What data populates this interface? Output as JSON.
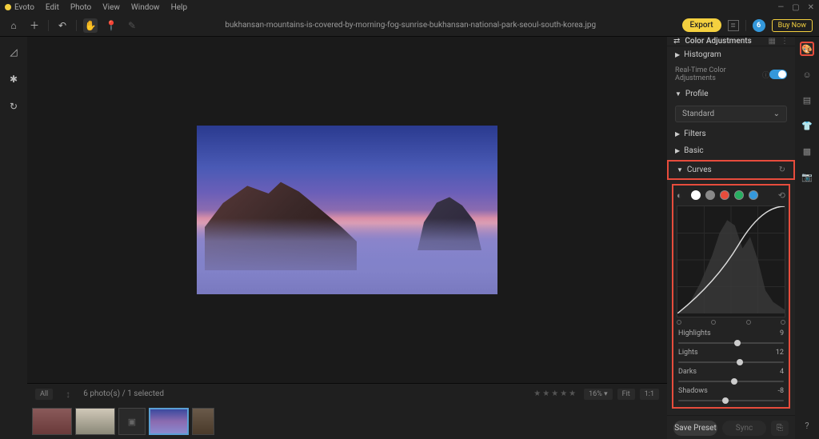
{
  "menu": {
    "items": [
      "Evoto",
      "Edit",
      "Photo",
      "View",
      "Window",
      "Help"
    ]
  },
  "toolbar": {
    "filename": "bukhansan-mountains-is-covered-by-morning-fog-sunrise-bukhansan-national-park-seoul-south-korea.jpg",
    "export": "Export",
    "badge": "6",
    "buy": "Buy Now"
  },
  "bottom": {
    "all": "All",
    "count": "6 photo(s) / 1 selected",
    "zoom": "16%",
    "fit": "Fit",
    "ratio": "1:1"
  },
  "panel": {
    "title": "Color Adjustments",
    "histogram": "Histogram",
    "realtime": "Real-Time Color Adjustments",
    "profile": "Profile",
    "profile_val": "Standard",
    "filters": "Filters",
    "basic": "Basic",
    "curves": "Curves",
    "sliders": {
      "highlights": {
        "label": "Highlights",
        "value": "9",
        "pos": 56
      },
      "lights": {
        "label": "Lights",
        "value": "12",
        "pos": 58
      },
      "darks": {
        "label": "Darks",
        "value": "4",
        "pos": 53
      },
      "shadows": {
        "label": "Shadows",
        "value": "-8",
        "pos": 45
      }
    },
    "save": "Save Preset",
    "sync": "Sync"
  }
}
